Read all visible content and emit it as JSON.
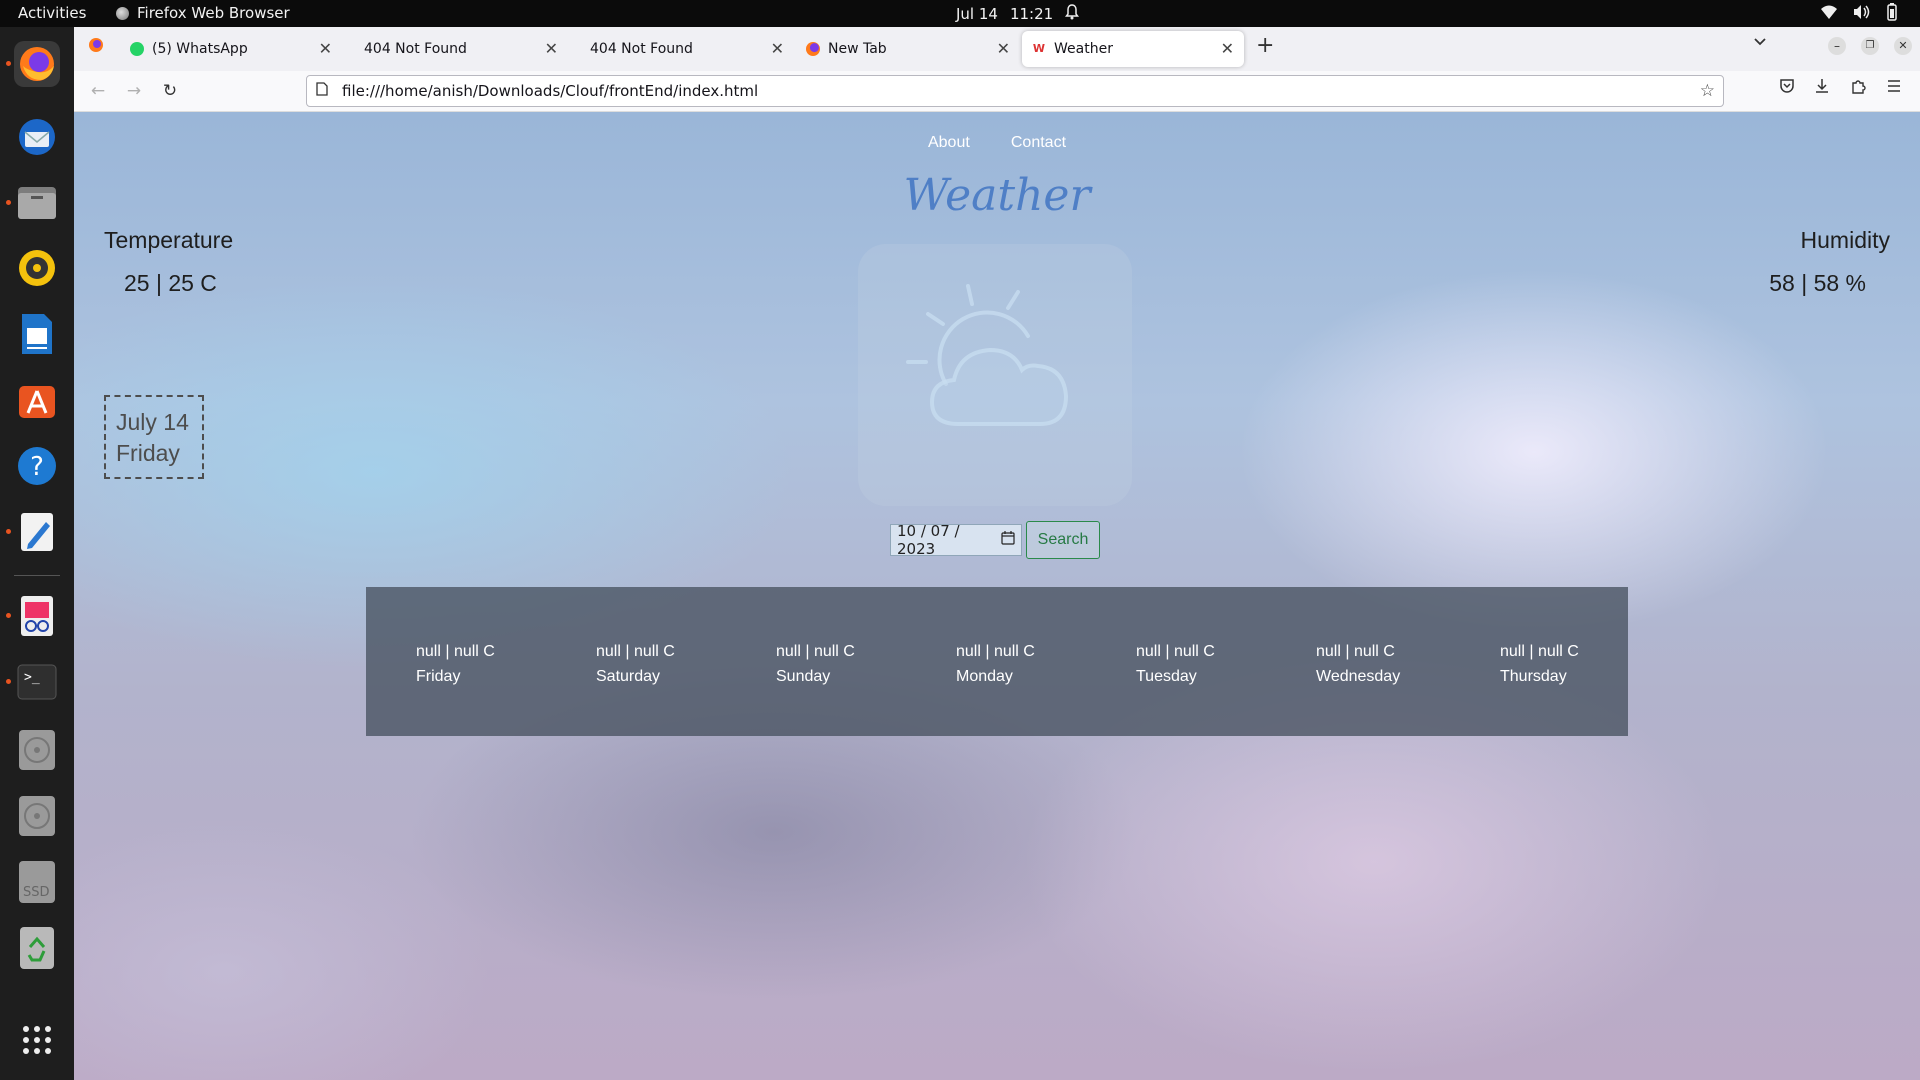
{
  "system_bar": {
    "activities": "Activities",
    "app_name": "Firefox Web Browser",
    "date": "Jul 14",
    "time": "11:21"
  },
  "dock": {
    "items": [
      "firefox-icon",
      "thunderbird-icon",
      "files-icon",
      "rhythmbox-icon",
      "writer-icon",
      "app-center-icon",
      "help-icon",
      "text-editor-icon",
      "image-viewer-icon",
      "terminal-icon",
      "disc-icon",
      "disc-icon",
      "ssd-drive-icon",
      "trash-icon",
      "show-apps-icon"
    ],
    "ssd_label": "SSD"
  },
  "browser": {
    "tabs": [
      {
        "label": "(5) WhatsApp"
      },
      {
        "label": "404 Not Found"
      },
      {
        "label": "404 Not Found"
      },
      {
        "label": "New Tab"
      },
      {
        "label": "Weather"
      }
    ],
    "url": "file:///home/anish/Downloads/Clouf/frontEnd/index.html"
  },
  "page": {
    "nav": {
      "about": "About",
      "contact": "Contact"
    },
    "title": "Weather",
    "temperature": {
      "heading": "Temperature",
      "value": "25 | 25 C"
    },
    "humidity": {
      "heading": "Humidity",
      "value": "58 | 58 %"
    },
    "date_box": {
      "line1": "July 14",
      "line2": "Friday"
    },
    "date_input": "10 / 07 / 2023",
    "search_label": "Search",
    "forecast": [
      {
        "temp": "null | null C",
        "day": "Friday"
      },
      {
        "temp": "null | null C",
        "day": "Saturday"
      },
      {
        "temp": "null | null C",
        "day": "Sunday"
      },
      {
        "temp": "null | null C",
        "day": "Monday"
      },
      {
        "temp": "null | null C",
        "day": "Tuesday"
      },
      {
        "temp": "null | null C",
        "day": "Wednesday"
      },
      {
        "temp": "null | null C",
        "day": "Thursday"
      }
    ]
  },
  "colors": {
    "title": "#4f7fc6",
    "search_accent": "#267a44",
    "forecast_bg": "#485260",
    "ubuntu_orange": "#e95420"
  }
}
